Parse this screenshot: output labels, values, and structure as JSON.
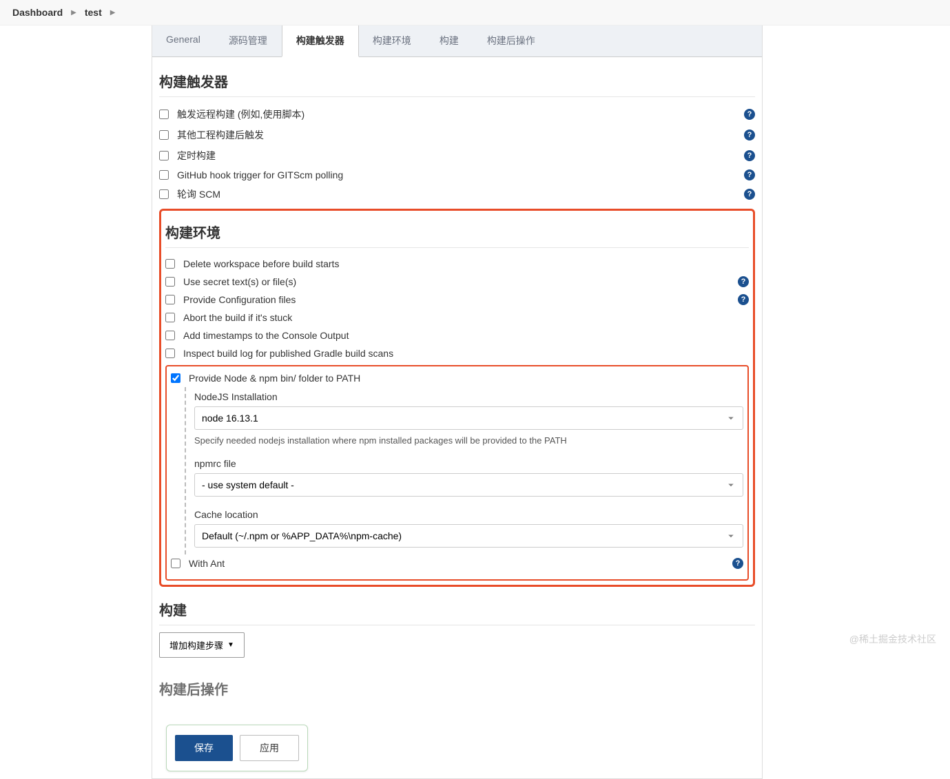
{
  "breadcrumb": {
    "items": [
      "Dashboard",
      "test"
    ]
  },
  "tabs": [
    {
      "label": "General",
      "active": false
    },
    {
      "label": "源码管理",
      "active": false
    },
    {
      "label": "构建触发器",
      "active": true
    },
    {
      "label": "构建环境",
      "active": false
    },
    {
      "label": "构建",
      "active": false
    },
    {
      "label": "构建后操作",
      "active": false
    }
  ],
  "sections": {
    "triggers": {
      "title": "构建触发器",
      "options": [
        {
          "label": "触发远程构建 (例如,使用脚本)",
          "checked": false,
          "help": true
        },
        {
          "label": "其他工程构建后触发",
          "checked": false,
          "help": true
        },
        {
          "label": "定时构建",
          "checked": false,
          "help": true
        },
        {
          "label": "GitHub hook trigger for GITScm polling",
          "checked": false,
          "help": true
        },
        {
          "label": "轮询 SCM",
          "checked": false,
          "help": true
        }
      ]
    },
    "environment": {
      "title": "构建环境",
      "options": [
        {
          "label": "Delete workspace before build starts",
          "checked": false,
          "help": false
        },
        {
          "label": "Use secret text(s) or file(s)",
          "checked": false,
          "help": true
        },
        {
          "label": "Provide Configuration files",
          "checked": false,
          "help": true
        },
        {
          "label": "Abort the build if it's stuck",
          "checked": false,
          "help": false
        },
        {
          "label": "Add timestamps to the Console Output",
          "checked": false,
          "help": false
        },
        {
          "label": "Inspect build log for published Gradle build scans",
          "checked": false,
          "help": false
        }
      ],
      "node_option": {
        "label": "Provide Node & npm bin/ folder to PATH",
        "checked": true,
        "fields": {
          "nodejs_install": {
            "label": "NodeJS Installation",
            "value": "node 16.13.1",
            "help_text": "Specify needed nodejs installation where npm installed packages will be provided to the PATH"
          },
          "npmrc": {
            "label": "npmrc file",
            "value": "- use system default -"
          },
          "cache": {
            "label": "Cache location",
            "value": "Default (~/.npm or %APP_DATA%\\npm-cache)"
          }
        }
      },
      "with_ant": {
        "label": "With Ant",
        "checked": false,
        "help": true
      }
    },
    "build": {
      "title": "构建",
      "add_step_label": "增加构建步骤"
    },
    "post_build": {
      "title": "构建后操作"
    }
  },
  "actions": {
    "save": "保存",
    "apply": "应用"
  },
  "watermark": "@稀土掘金技术社区"
}
